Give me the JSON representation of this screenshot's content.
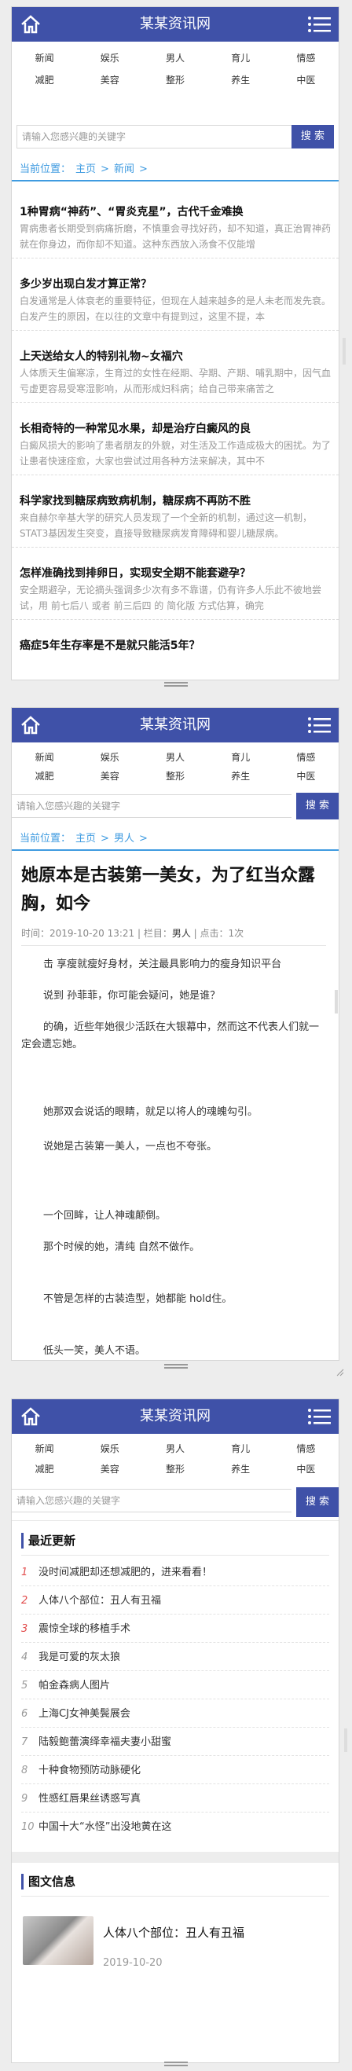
{
  "colors": {
    "brand": "#3f51a8",
    "link": "#3f9be0",
    "rank_red": "#e24d4d"
  },
  "site": {
    "title": "某某资讯网"
  },
  "nav": {
    "row1": [
      "新闻",
      "娱乐",
      "男人",
      "育儿",
      "情感"
    ],
    "row2": [
      "减肥",
      "美容",
      "整形",
      "养生",
      "中医"
    ]
  },
  "search": {
    "placeholder": "请输入您感兴趣的关键字",
    "button": "搜 索"
  },
  "screen1": {
    "breadcrumb": {
      "label": "当前位置：",
      "home": "主页",
      "current": "新闻"
    },
    "articles": [
      {
        "title": "1种胃病“神药”、“胃炎克星”，古代千金难换",
        "summary": "胃病患者长期受到病痛折磨，不慎重会寻找好药，却不知道，真正治胃神药就在你身边，而你却不知道。这种东西放入汤食不仅能增"
      },
      {
        "title": "多少岁出现白发才算正常？",
        "summary": "白发通常是人体衰老的重要特征，但现在人越来越多的是人未老而发先衰。白发产生的原因，在以往的文章中有提到过，这里不提，本"
      },
      {
        "title": "上天送给女人的特别礼物~女福穴",
        "summary": "人体质天生偏寒凉，生育过的女性在经期、孕期、产期、哺乳期中，因气血亏虚更容易受寒湿影响，从而形成妇科病；给自己带来痛苦之"
      },
      {
        "title": "长相奇特的一种常见水果，却是治疗白癜风的良",
        "summary": "白癜风损大的影响了患者朋友的外貌，对生活及工作造成极大的困扰。为了让患者快速痊愈，大家也尝试过用各种方法来解决，其中不"
      },
      {
        "title": "科学家找到糖尿病致病机制，糖尿病不再防不胜",
        "summary": "来自赫尔辛基大学的研究人员发现了一个全新的机制，通过这一机制，STAT3基因发生突变，直接导致糖尿病发育障碍和婴儿糖尿病。"
      },
      {
        "title": "怎样准确找到排卵日，实现安全期不能套避孕？",
        "summary": "安全期避孕，无论摘头强调多少次有多不靠谱，仍有许多人乐此不彼地尝试，用 前七后八 或者 前三后四 的 简化版 方式估算，确完"
      },
      {
        "title": "癌症5年生存率是不是就只能活5年？",
        "summary": ""
      }
    ]
  },
  "screen2": {
    "breadcrumb": {
      "label": "当前位置：",
      "home": "主页",
      "current": "男人"
    },
    "post": {
      "title": "她原本是古装第一美女，为了红当众露胸，如今",
      "time_label": "时间：",
      "time": "2019-10-20 13:21",
      "category_label": "栏目：",
      "category": "男人",
      "views_label": "点击：",
      "views": "1次",
      "paragraphs": [
        "击 享瘦就瘦好身材，关注最具影响力的瘦身知识平台",
        "说到 孙菲菲，你可能会疑问，她是谁？",
        "的确，近些年她很少活跃在大银幕中，然而这不代表人们就一定会遗忘她。",
        "她那双会说话的眼睛，就足以将人的魂魄勾引。",
        "说她是古装第一美人，一点也不夸张。",
        "一个回眸，让人神魂颠倒。",
        "那个时候的她，清纯 自然不做作。",
        "不管是怎样的古装造型，她都能 hold住。",
        "低头一笑，美人不语。"
      ]
    }
  },
  "screen3": {
    "recent_heading": "最近更新",
    "recent": [
      "没时间减肥却还想减肥的，进来看看！",
      "人体八个部位：丑人有丑福",
      "震惊全球的移植手术",
      "我是可爱的灰太狼",
      "帕金森病人图片",
      "上海CJ女神美鬓展会",
      "陆毅鲍蕾演绎幸福夫妻小甜蜜",
      "十种食物预防动脉硬化",
      "性感红唇果丝诱惑写真",
      "中国十大“水怪”出没地黄在这"
    ],
    "image_heading": "图文信息",
    "image_post": {
      "title": "人体八个部位：丑人有丑福",
      "date": "2019-10-20"
    }
  }
}
